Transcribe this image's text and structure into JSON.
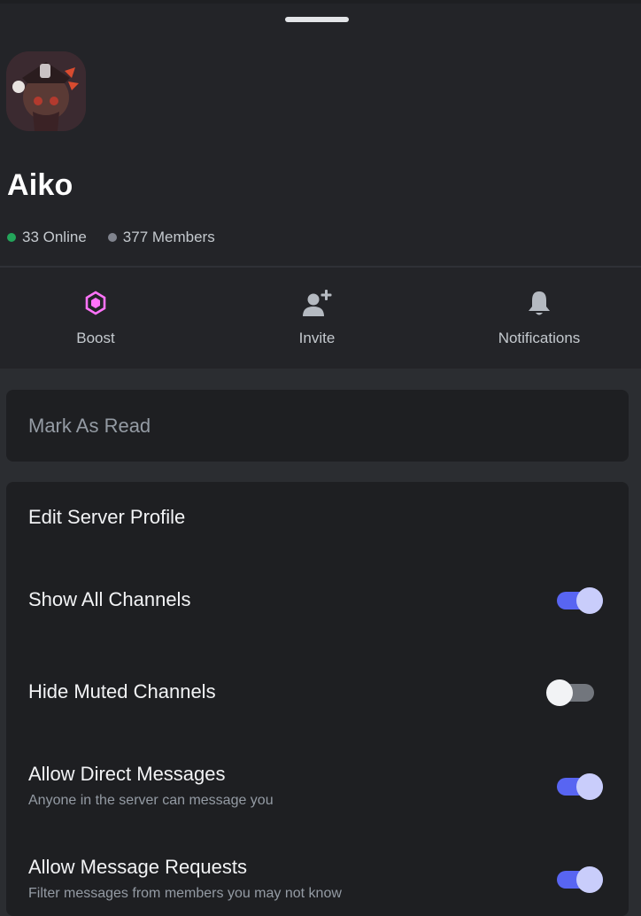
{
  "server": {
    "name": "Aiko",
    "online": "33 Online",
    "members": "377 Members"
  },
  "actions": [
    {
      "label": "Boost",
      "icon": "boost-gem-icon"
    },
    {
      "label": "Invite",
      "icon": "add-user-icon"
    },
    {
      "label": "Notifications",
      "icon": "bell-icon"
    }
  ],
  "mark_as_read": "Mark As Read",
  "settings": [
    {
      "title": "Edit Server Profile",
      "subtitle": "",
      "toggle": null
    },
    {
      "title": "Show All Channels",
      "subtitle": "",
      "toggle": true
    },
    {
      "title": "Hide Muted Channels",
      "subtitle": "",
      "toggle": false
    },
    {
      "title": "Allow Direct Messages",
      "subtitle": "Anyone in the server can message you",
      "toggle": true
    },
    {
      "title": "Allow Message Requests",
      "subtitle": "Filter messages from members you may not know",
      "toggle": true
    }
  ],
  "colors": {
    "accent": "#5865f2",
    "online": "#23a55a",
    "boost": "#ff73fa"
  }
}
